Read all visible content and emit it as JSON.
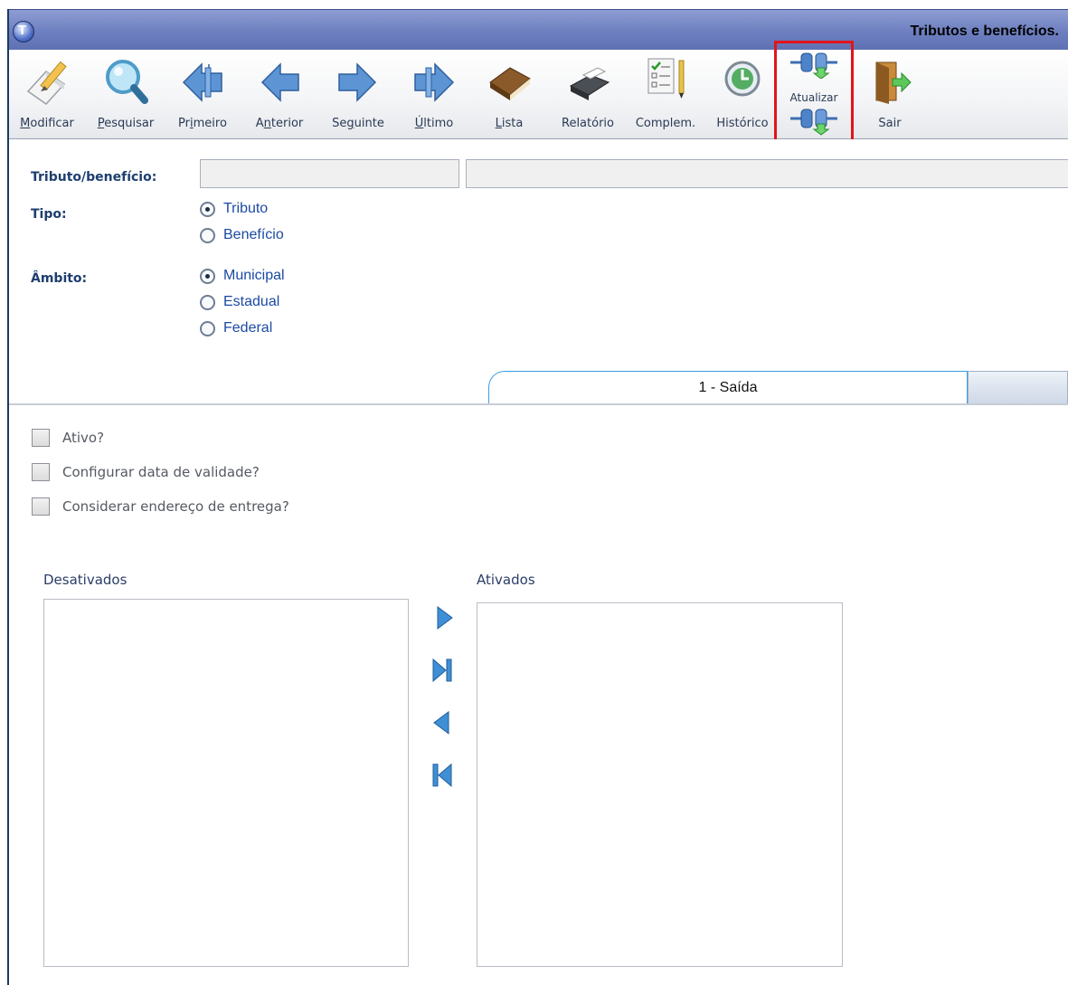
{
  "window": {
    "title": "Tributos e benefícios."
  },
  "toolbar": {
    "buttons": [
      {
        "key": "M",
        "rest": "odificar",
        "icon": "pencil-icon"
      },
      {
        "key": "P",
        "rest": "esquisar",
        "icon": "magnifier-icon"
      },
      {
        "pre": "Pr",
        "key": "i",
        "rest": "meiro",
        "icon": "first-arrow-icon"
      },
      {
        "pre": "A",
        "key": "n",
        "rest": "terior",
        "icon": "previous-arrow-icon"
      },
      {
        "pre": "Se",
        "key": "g",
        "rest": "uinte",
        "icon": "next-arrow-icon"
      },
      {
        "key": "Ú",
        "rest": "ltimo",
        "icon": "last-arrow-icon"
      },
      {
        "key": "L",
        "rest": "ista",
        "icon": "book-icon"
      },
      {
        "pre": "Relatório",
        "icon": "printer-icon"
      },
      {
        "pre": "Complem.",
        "icon": "checklist-icon"
      },
      {
        "pre": "Histórico",
        "icon": "history-icon"
      },
      {
        "pre": "Atualizar",
        "icon": "plug-update-icon"
      },
      {
        "pre": "Sair",
        "icon": "exit-door-icon"
      }
    ]
  },
  "form": {
    "tributo_label": "Tributo/benefício:",
    "tributo_code": "",
    "tributo_desc": "",
    "tipo_label": "Tipo:",
    "tipo_options": [
      "Tributo",
      "Benefício"
    ],
    "tipo_selected": "Tributo",
    "ambito_label": "Âmbito:",
    "ambito_options": [
      "Municipal",
      "Estadual",
      "Federal"
    ],
    "ambito_selected": "Municipal"
  },
  "tabs": {
    "active": "1 - Saída"
  },
  "panel": {
    "checkboxes": [
      "Ativo?",
      "Configurar data de validade?",
      "Considerar endereço de entrega?"
    ],
    "desativados_label": "Desativados",
    "ativados_label": "Ativados",
    "move_buttons": [
      "move-right-icon",
      "move-all-right-icon",
      "move-left-icon",
      "move-all-left-icon"
    ]
  },
  "colors": {
    "accent_highlight": "#e1141c",
    "title_bar": "#6d7fbf",
    "label_blue": "#1e3e6e",
    "option_blue": "#1b4aa3",
    "tab_border": "#3a9ee6"
  }
}
